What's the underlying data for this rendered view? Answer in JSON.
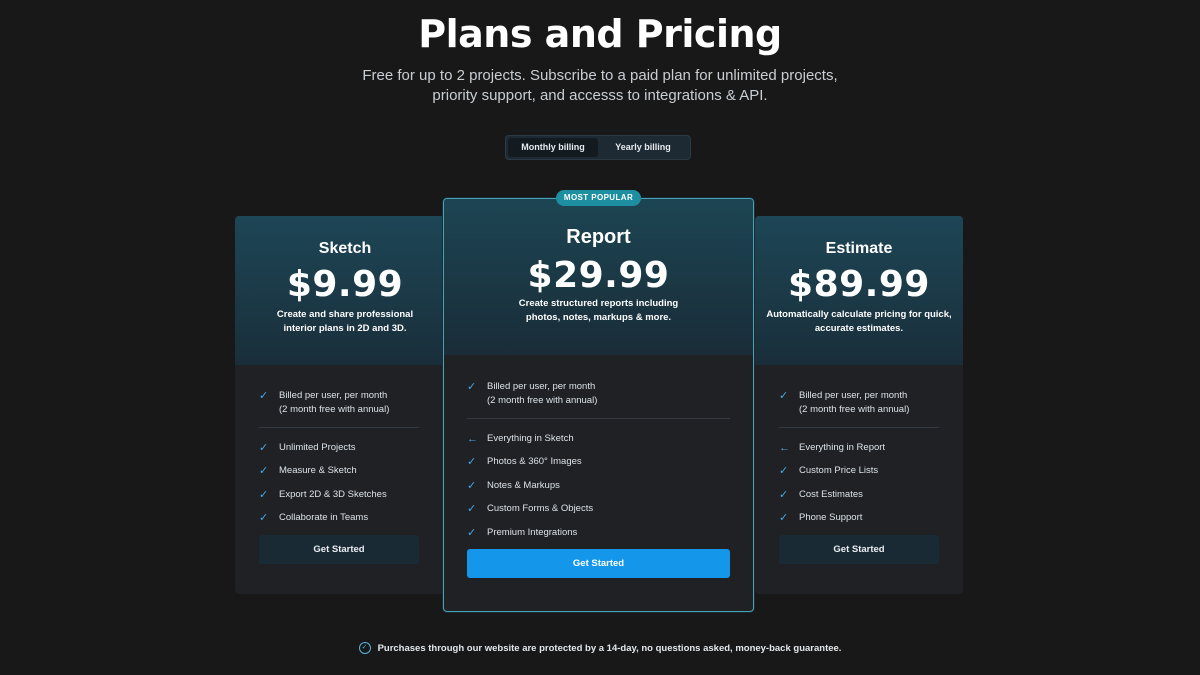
{
  "header": {
    "title": "Plans and Pricing",
    "subtitle_line1": "Free for up to 2 projects. Subscribe to a paid plan for unlimited projects,",
    "subtitle_line2": "priority support, and accesss to integrations & API."
  },
  "billing": {
    "options": [
      "Monthly billing",
      "Yearly billing"
    ],
    "selected": "Monthly billing"
  },
  "badge": "MOST POPULAR",
  "plans": [
    {
      "name": "Sketch",
      "price": "$9.99",
      "desc_line1": "Create and share professional",
      "desc_line2": "interior plans in 2D and 3D.",
      "billing_line1": "Billed per user, per month",
      "billing_line2": "(2 month free with annual)",
      "features": [
        "Unlimited Projects",
        "Measure & Sketch",
        "Export 2D & 3D Sketches",
        "Collaborate in Teams"
      ],
      "cta": "Get Started"
    },
    {
      "name": "Report",
      "price": "$29.99",
      "desc_line1": "Create structured reports including",
      "desc_line2": "photos, notes, markups & more.",
      "billing_line1": "Billed per user, per month",
      "billing_line2": "(2 month free with annual)",
      "features": [
        "Everything in Sketch",
        "Photos & 360° Images",
        "Notes & Markups",
        "Custom Forms & Objects",
        "Premium Integrations"
      ],
      "cta": "Get Started"
    },
    {
      "name": "Estimate",
      "price": "$89.99",
      "desc_line1": "Automatically calculate pricing for quick,",
      "desc_line2": "accurate estimates.",
      "billing_line1": "Billed per user, per month",
      "billing_line2": "(2 month free with annual)",
      "features": [
        "Everything in Report",
        "Custom Price Lists",
        "Cost Estimates",
        "Phone Support"
      ],
      "cta": "Get Started"
    }
  ],
  "guarantee": "Purchases through our website are protected by a 14-day, no questions asked, money-back guarantee.",
  "icons": {
    "check": "check-icon",
    "arrow": "arrow-left-icon",
    "guarantee": "check-circle-icon"
  },
  "colors": {
    "accent": "#1497ea",
    "check": "#48a8e6",
    "badge": "#1d8fa0",
    "background": "#181818"
  }
}
